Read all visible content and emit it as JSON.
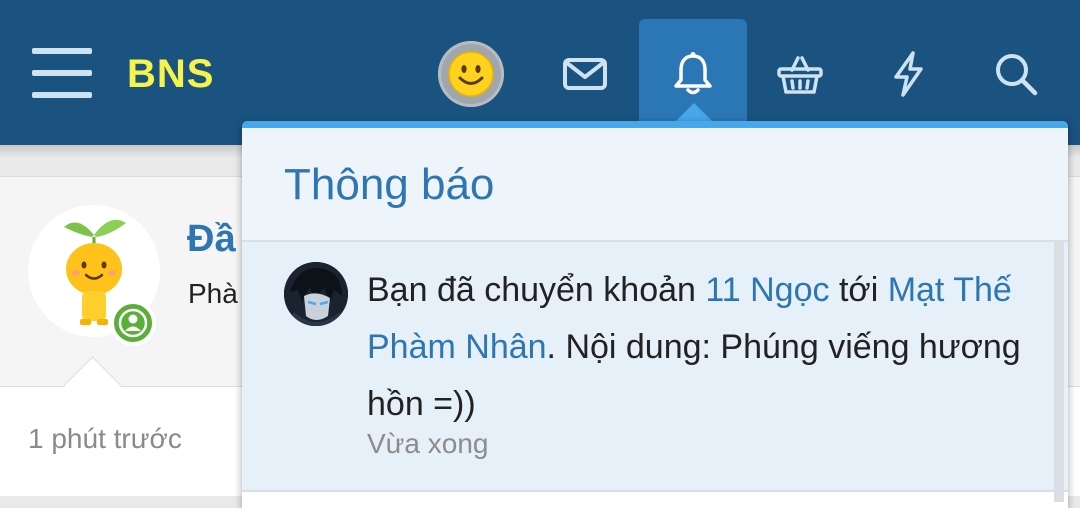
{
  "header": {
    "logo": "BNS",
    "icons": [
      "menu-icon",
      "avatar",
      "envelope-icon",
      "bell-icon",
      "basket-icon",
      "lightning-icon",
      "search-icon"
    ],
    "colors": {
      "bar": "#1a5380",
      "active_tab": "#2b77b6",
      "logo": "#f6f34a"
    }
  },
  "background_post": {
    "name_partial": "Đầ",
    "subtitle_partial": "Phà",
    "time": "1 phút trước"
  },
  "notifications": {
    "title": "Thông báo",
    "items": [
      {
        "text_1": "Bạn đã chuyển khoản ",
        "amount": "11 Ngọc",
        "text_2": " tới ",
        "recipient": "Mạt Thế Phàm Nhân",
        "text_3": ". Nội dung: Phúng viếng hương hồn =))",
        "time": "Vừa xong"
      }
    ],
    "colors": {
      "accent": "#47a7eb",
      "link": "#2d76b2",
      "item_bg": "#e6f0f8"
    }
  }
}
